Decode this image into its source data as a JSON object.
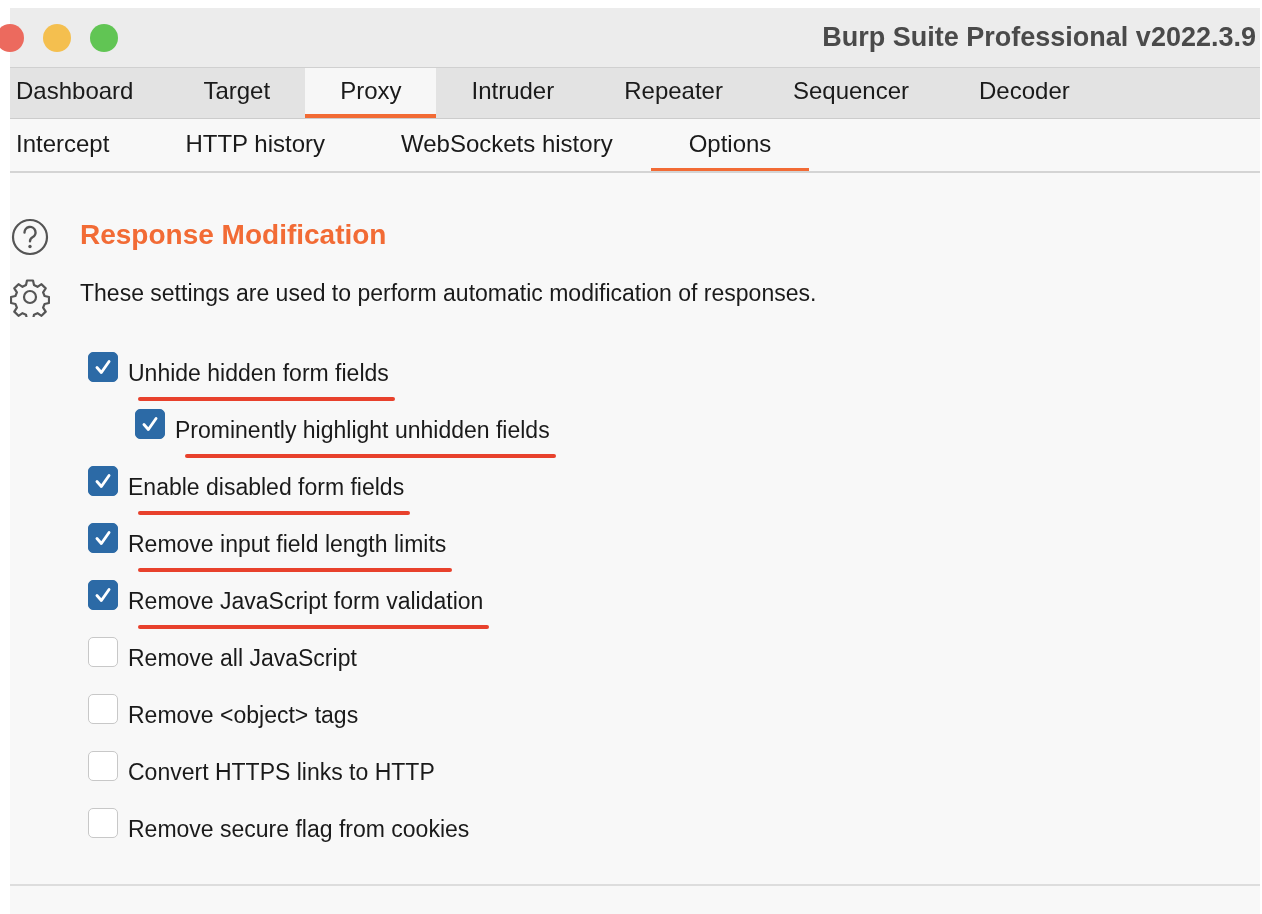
{
  "window": {
    "title": "Burp Suite Professional v2022.3.9"
  },
  "tabs": [
    {
      "label": "Dashboard",
      "selected": false
    },
    {
      "label": "Target",
      "selected": false
    },
    {
      "label": "Proxy",
      "selected": true
    },
    {
      "label": "Intruder",
      "selected": false
    },
    {
      "label": "Repeater",
      "selected": false
    },
    {
      "label": "Sequencer",
      "selected": false
    },
    {
      "label": "Decoder",
      "selected": false
    }
  ],
  "subtabs": [
    {
      "label": "Intercept",
      "selected": false
    },
    {
      "label": "HTTP history",
      "selected": false
    },
    {
      "label": "WebSockets history",
      "selected": false
    },
    {
      "label": "Options",
      "selected": true
    }
  ],
  "section": {
    "title": "Response Modification",
    "description": "These settings are used to perform automatic modification of responses."
  },
  "options": [
    {
      "label": "Unhide hidden form fields",
      "checked": true,
      "underlined": true,
      "children": [
        {
          "label": "Prominently highlight unhidden fields",
          "checked": true,
          "underlined": true
        }
      ]
    },
    {
      "label": "Enable disabled form fields",
      "checked": true,
      "underlined": true
    },
    {
      "label": "Remove input field length limits",
      "checked": true,
      "underlined": true
    },
    {
      "label": "Remove JavaScript form validation",
      "checked": true,
      "underlined": true
    },
    {
      "label": "Remove all JavaScript",
      "checked": false,
      "underlined": false
    },
    {
      "label": "Remove <object> tags",
      "checked": false,
      "underlined": false
    },
    {
      "label": "Convert HTTPS links to HTTP",
      "checked": false,
      "underlined": false
    },
    {
      "label": "Remove secure flag from cookies",
      "checked": false,
      "underlined": false
    }
  ]
}
